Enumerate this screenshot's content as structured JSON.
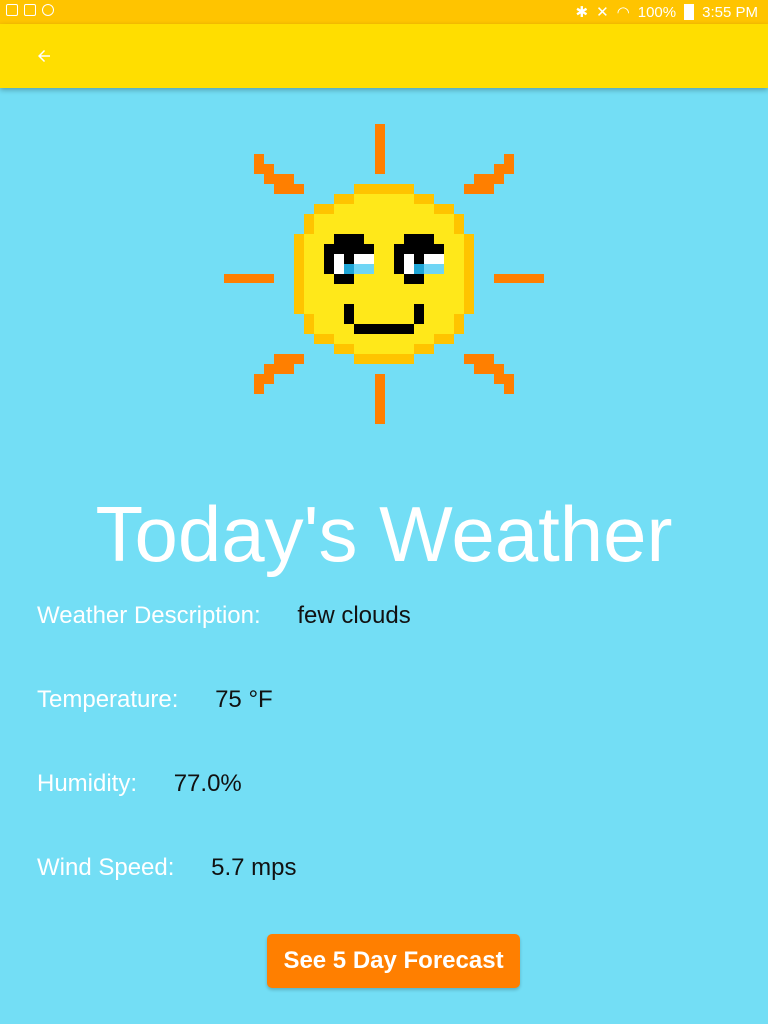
{
  "status_bar": {
    "battery": "100%",
    "time": "3:55 PM"
  },
  "app_bar": {
    "back_icon": "arrow-left-icon"
  },
  "main": {
    "title": "Today's Weather",
    "rows": [
      {
        "label": "Weather Description:",
        "value": "few clouds"
      },
      {
        "label": "Temperature:",
        "value": "75 °F"
      },
      {
        "label": "Humidity:",
        "value": "77.0%"
      },
      {
        "label": "Wind Speed:",
        "value": "5.7 mps"
      }
    ]
  },
  "button": {
    "label": "See 5 Day Forecast"
  },
  "colors": {
    "background": "#73DEF5",
    "app_bar": "#FFDE00",
    "status_bar": "#FFC400",
    "accent": "#FF7F00"
  }
}
